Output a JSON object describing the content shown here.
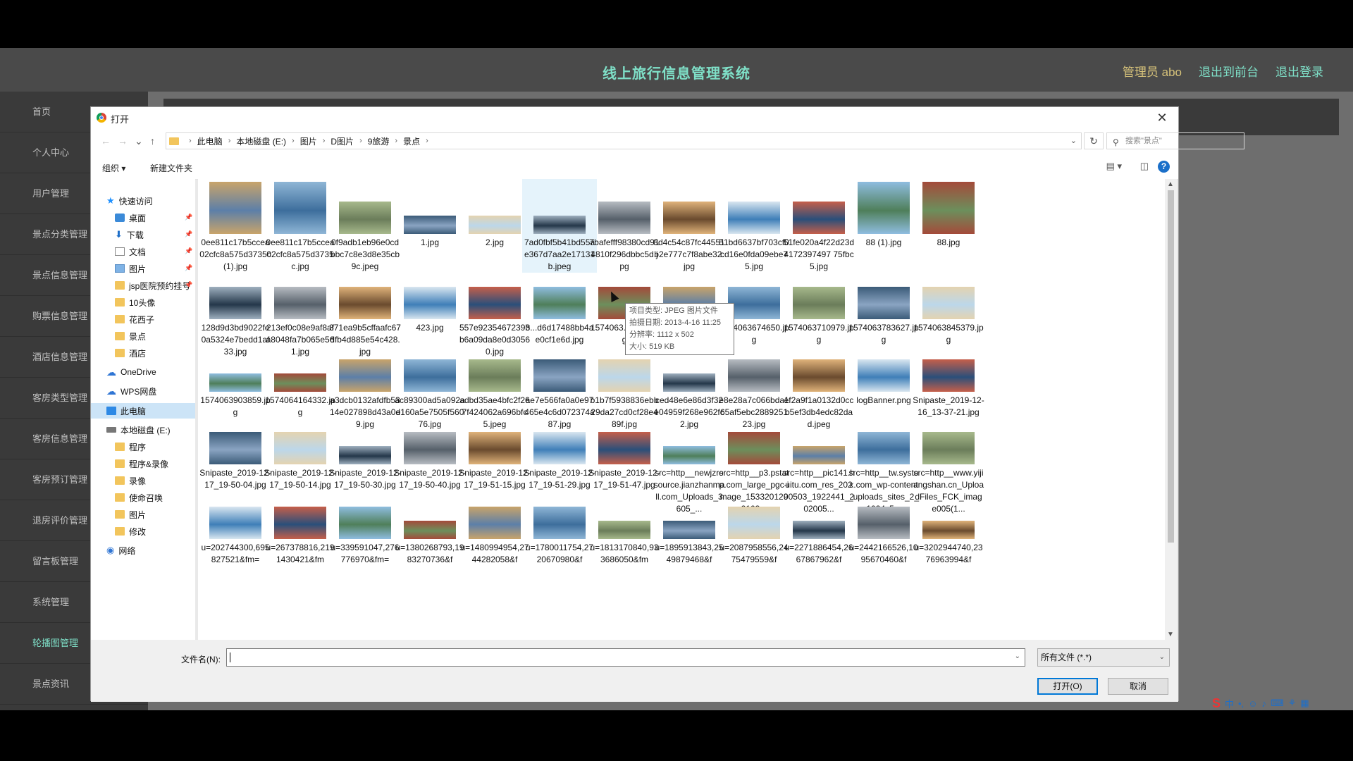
{
  "app": {
    "title": "线上旅行信息管理系统",
    "admin_label": "管理员 abo",
    "back_to_front": "退出到前台",
    "logout": "退出登录"
  },
  "sidebar": {
    "items": [
      {
        "label": "首页"
      },
      {
        "label": "个人中心"
      },
      {
        "label": "用户管理"
      },
      {
        "label": "景点分类管理"
      },
      {
        "label": "景点信息管理"
      },
      {
        "label": "购票信息管理"
      },
      {
        "label": "酒店信息管理"
      },
      {
        "label": "客房类型管理"
      },
      {
        "label": "客房信息管理"
      },
      {
        "label": "客房预订管理"
      },
      {
        "label": "退房评价管理"
      },
      {
        "label": "留言板管理"
      },
      {
        "label": "系统管理"
      },
      {
        "label": "轮播图管理"
      },
      {
        "label": "景点资讯"
      }
    ]
  },
  "dialog": {
    "title": "打开",
    "close_glyph": "✕",
    "breadcrumbs": [
      "此电脑",
      "本地磁盘 (E:)",
      "图片",
      "D图片",
      "9旅游",
      "景点"
    ],
    "search_placeholder": "搜索\"景点\"",
    "toolbar": {
      "organize": "组织 ▾",
      "new_folder": "新建文件夹",
      "help": "?"
    },
    "nav": [
      {
        "label": "快速访问",
        "icon": "star-icon",
        "pinned": false
      },
      {
        "label": "桌面",
        "icon": "desktop-icon",
        "pinned": true
      },
      {
        "label": "下载",
        "icon": "download-icon",
        "pinned": true
      },
      {
        "label": "文档",
        "icon": "document-icon",
        "pinned": true
      },
      {
        "label": "图片",
        "icon": "pictures-icon",
        "pinned": true
      },
      {
        "label": "jsp医院预约挂号",
        "icon": "folder-icon",
        "pinned": true
      },
      {
        "label": "10头像",
        "icon": "folder-icon",
        "pinned": false
      },
      {
        "label": "花西子",
        "icon": "folder-icon",
        "pinned": false
      },
      {
        "label": "景点",
        "icon": "folder-icon",
        "pinned": false
      },
      {
        "label": "酒店",
        "icon": "folder-icon",
        "pinned": false
      },
      {
        "label": "OneDrive",
        "icon": "cloud-icon",
        "pinned": false
      },
      {
        "label": "WPS网盘",
        "icon": "cloud-icon",
        "pinned": false
      },
      {
        "label": "此电脑",
        "icon": "computer-icon",
        "pinned": false
      },
      {
        "label": "本地磁盘 (E:)",
        "icon": "drive-icon",
        "pinned": false
      },
      {
        "label": "程序",
        "icon": "folder-icon",
        "pinned": false
      },
      {
        "label": "程序&录像",
        "icon": "folder-icon",
        "pinned": false
      },
      {
        "label": "录像",
        "icon": "folder-icon",
        "pinned": false
      },
      {
        "label": "使命召唤",
        "icon": "folder-icon",
        "pinned": false
      },
      {
        "label": "图片",
        "icon": "folder-icon",
        "pinned": false
      },
      {
        "label": "修改",
        "icon": "folder-icon",
        "pinned": false
      },
      {
        "label": "网络",
        "icon": "network-icon",
        "pinned": false
      }
    ],
    "files": [
      [
        "0ee811c17b5ccea02cfc8a575d3735c (1).jpg",
        "0ee811c17b5ccea02cfc8a575d3735c.jpg",
        "0f9adb1eb96e0cdbbc7c8e3d8e35cb9c.jpeg",
        "1.jpg",
        "2.jpg",
        "7ad0fbf5b41bd55ae367d7aa2e17131b.jpeg",
        "7bafefff98380cd914810f296dbbc5d.jpg",
        "8d4c54c87fc44551b2e777c7f8abe32.jpg",
        "51bd6637bf703cf0cd16e0fda09ebe75.jpg",
        "51fe020a4f22d23d4172397497 75fbc5.jpg",
        "88 (1).jpg",
        "88.jpg"
      ],
      [
        "128d9d3bd9022fe0a5324e7bedd1af33.jpg",
        "213ef0c08e9af8afa8048fa7b065e561.jpg",
        "371ea9b5cffaafc67dfb4d885e54c428.jpg",
        "423.jpg",
        "557e9235467239bb6a09da8e0d30560.jpg",
        "3...d6d17488bb4ae0cf1e6d.jpg",
        "1574063...4820.jpg",
        "1574063501836.jpg",
        "1574063674650.jpg",
        "1574063710979.jpg",
        "1574063783627.jpg",
        "1574063845379.jpg"
      ],
      [
        "1574063903859.jpg",
        "1574064164332.jpg",
        "a3dcb0132afdfb5314e027898d43a0d9.jpg",
        "ac89300ad5a092ae160a5e7505f56076.jpg",
        "adbd35ae4bfc2f267f424062a696bfc5.jpeg",
        "ae7e566fa0a0e97465e4c6d072374a87.jpg",
        "b1b7f5938836ebb29da27cd0cf28e489f.jpg",
        "ced48e6e86d3f32e04959f268e962fc2.jpg",
        "e8e28a7c066bda165af5ebc288925123.jpg",
        "ef2a9f1a0132d0ccb5ef3db4edc82dad.jpeg",
        "logBanner.png",
        "Snipaste_2019-12-16_13-37-21.jpg"
      ],
      [
        "Snipaste_2019-12-17_19-50-04.jpg",
        "Snipaste_2019-12-17_19-50-14.jpg",
        "Snipaste_2019-12-17_19-50-30.jpg",
        "Snipaste_2019-12-17_19-50-40.jpg",
        "Snipaste_2019-12-17_19-51-15.jpg",
        "Snipaste_2019-12-17_19-51-29.jpg",
        "Snipaste_2019-12-17_19-51-47.jpg",
        "src=http__newjzresource.jianzhanmall.com_Uploads_3605_...",
        "src=http__p3.pstatp.com_large_pgc-image_1533201292103...",
        "src=http__pic141.huitu.com_res_20200503_1922441_202005...",
        "src=http__tw.systex.com_wp-content_uploads_sites_2_1024x5...",
        "src=http__www.yijiangshan.cn_UploadFiles_FCK_image005(1..."
      ],
      [
        "u=202744300,695827521&fm=",
        "u=267378816,2191430421&fm",
        "u=339591047,276776970&fm=",
        "u=1380268793,1983270736&f",
        "u=1480994954,2744282058&f",
        "u=1780011754,2720670980&f",
        "u=1813170840,933686050&fm",
        "u=1895913843,2549879468&f",
        "u=2087958556,2475479559&f",
        "u=2271886454,2667867962&f",
        "u=2442166526,1095670460&f",
        "u=3202944740,2376963994&f"
      ]
    ],
    "tooltip": {
      "line1": "项目类型: JPEG 图片文件",
      "line2": "拍摄日期: 2013-4-16 11:25",
      "line3": "分辨率: 1112 x 502",
      "line4": "大小: 519 KB"
    },
    "filename_label": "文件名(N):",
    "filename_value": "",
    "filter_value": "所有文件 (*.*)",
    "open_button": "打开(O)",
    "cancel_button": "取消"
  }
}
